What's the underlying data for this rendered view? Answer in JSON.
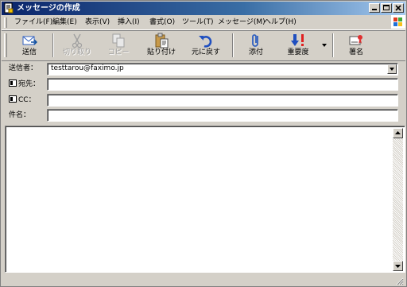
{
  "window": {
    "title": "メッセージの作成"
  },
  "menu": {
    "items": [
      {
        "label": "ファイル(F)"
      },
      {
        "label": "編集(E)"
      },
      {
        "label": "表示(V)"
      },
      {
        "label": "挿入(I)"
      },
      {
        "label": "書式(O)"
      },
      {
        "label": "ツール(T)"
      },
      {
        "label": "メッセージ(M)"
      },
      {
        "label": "ヘルプ(H)"
      }
    ]
  },
  "toolbar": {
    "buttons": [
      {
        "label": "送信",
        "icon": "send-icon",
        "enabled": true
      },
      {
        "label": "切り取り",
        "icon": "scissors-icon",
        "enabled": false
      },
      {
        "label": "コピー",
        "icon": "copy-icon",
        "enabled": false
      },
      {
        "label": "貼り付け",
        "icon": "paste-icon",
        "enabled": true
      },
      {
        "label": "元に戻す",
        "icon": "undo-icon",
        "enabled": true
      },
      {
        "label": "添付",
        "icon": "paperclip-icon",
        "enabled": true
      },
      {
        "label": "重要度",
        "icon": "priority-icon",
        "enabled": true
      },
      {
        "label": "署名",
        "icon": "signature-icon",
        "enabled": true
      }
    ]
  },
  "header": {
    "from_label": "送信者：",
    "from_value": "testtarou@faximo.jp",
    "to_label": "宛先：",
    "to_value": "",
    "cc_label": "CC：",
    "cc_value": "",
    "subject_label": "件名：",
    "subject_value": ""
  },
  "body": {
    "text": ""
  },
  "colors": {
    "titlebar_start": "#0a246a",
    "titlebar_end": "#a6caf0",
    "face": "#d4d0c8"
  }
}
